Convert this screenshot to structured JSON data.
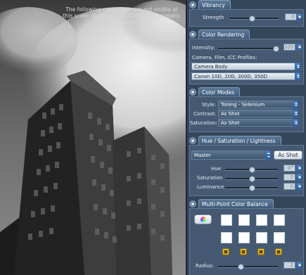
{
  "preview": {
    "notice": "The following corrections are not visible at this scale: Sharpness, DxO Noise, Chromatic Aberration"
  },
  "vibrancy": {
    "title": "Vibrancy",
    "strength_label": "Strength",
    "strength_value": "0"
  },
  "color_rendering": {
    "title": "Color Rendering",
    "intensity_label": "Intensity:",
    "intensity_value": "100",
    "profiles_label": "Camera, Film, ICC Profiles:",
    "profile_category": "Camera Body",
    "profile_model": "Canon 10D, 20D, 300D, 350D"
  },
  "color_modes": {
    "title": "Color Modes",
    "style_label": "Style:",
    "style_value": "Toning - Selenium",
    "contrast_label": "Contrast:",
    "contrast_value": "As Shot",
    "saturation_label": "Saturation:",
    "saturation_value": "As Shot"
  },
  "hsl": {
    "title": "Hue / Saturation / Lightness",
    "channel": "Master",
    "as_shot_button": "As Shot",
    "hue_label": "Hue",
    "hue_value": "0°",
    "saturation_label": "Saturation",
    "saturation_value": "0",
    "luminance_label": "Luminance",
    "luminance_value": "0"
  },
  "multipoint": {
    "title": "Multi-Point Color Balance",
    "radius_label": "Radius:",
    "radius_value": "2"
  }
}
